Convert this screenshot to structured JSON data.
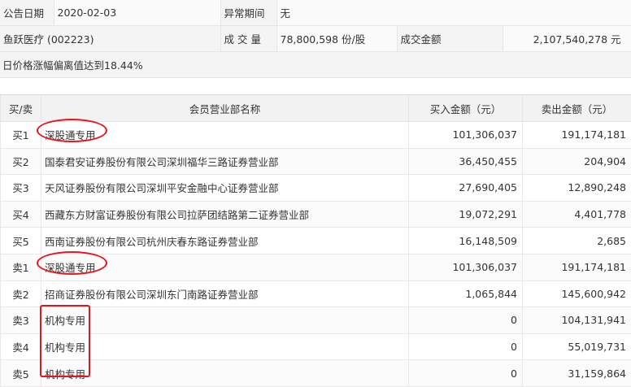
{
  "info": {
    "announce_date_label": "公告日期",
    "announce_date_value": "2020-02-03",
    "abnormal_period_label": "异常期间",
    "abnormal_period_value": "无",
    "stock_name": "鱼跃医疗 (002223)",
    "volume_label": "成 交 量",
    "volume_value": "78,800,598 份/股",
    "amount_label": "成交金额",
    "amount_value": "2,107,540,278 元",
    "note": "日价格涨幅偏离值达到18.44%"
  },
  "table": {
    "headers": [
      "买/卖",
      "会员营业部名称",
      "买入金额（元）",
      "卖出金额（元）"
    ],
    "rows": [
      {
        "side": "买1",
        "name": "深股通专用",
        "buy": "101,306,037",
        "sell": "191,174,181"
      },
      {
        "side": "买2",
        "name": "国泰君安证券股份有限公司深圳福华三路证券营业部",
        "buy": "36,450,455",
        "sell": "204,904"
      },
      {
        "side": "买3",
        "name": "天风证券股份有限公司深圳平安金融中心证券营业部",
        "buy": "27,690,405",
        "sell": "12,890,248"
      },
      {
        "side": "买4",
        "name": "西藏东方财富证券股份有限公司拉萨团结路第二证券营业部",
        "buy": "19,072,291",
        "sell": "4,401,778"
      },
      {
        "side": "买5",
        "name": "西南证券股份有限公司杭州庆春东路证券营业部",
        "buy": "16,148,509",
        "sell": "2,685"
      },
      {
        "side": "卖1",
        "name": "深股通专用",
        "buy": "101,306,037",
        "sell": "191,174,181"
      },
      {
        "side": "卖2",
        "name": "招商证券股份有限公司深圳东门南路证券营业部",
        "buy": "1,065,844",
        "sell": "145,600,942"
      },
      {
        "side": "卖3",
        "name": "机构专用",
        "buy": "0",
        "sell": "104,131,941"
      },
      {
        "side": "卖4",
        "name": "机构专用",
        "buy": "0",
        "sell": "55,019,731"
      },
      {
        "side": "卖5",
        "name": "机构专用",
        "buy": "0",
        "sell": "31,159,864"
      }
    ]
  },
  "annotation_color": "#e8141b"
}
